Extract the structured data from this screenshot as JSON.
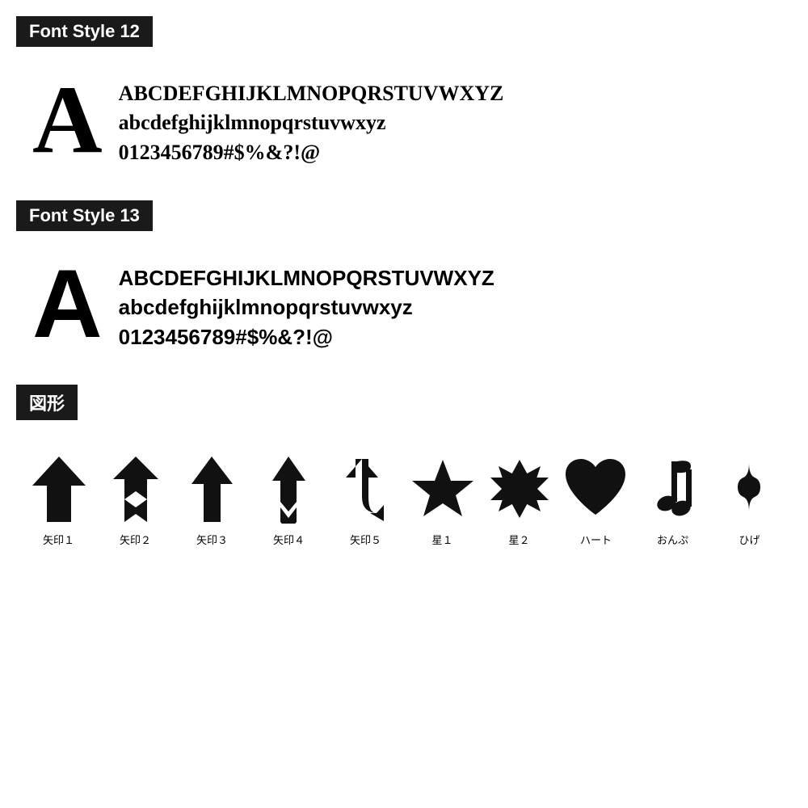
{
  "font12": {
    "header": "Font Style 12",
    "big_letter": "A",
    "line1": "ABCDEFGHIJKLMNOPQRSTUVWXYZ",
    "line2": "abcdefghijklmnopqrstuvwxyz",
    "line3": "0123456789#$%&?!@"
  },
  "font13": {
    "header": "Font Style 13",
    "big_letter": "A",
    "line1": "ABCDEFGHIJKLMNOPQRSTUVWXYZ",
    "line2": "abcdefghijklmnopqrstuvwxyz",
    "line3": "0123456789#$%&?!@"
  },
  "shapes": {
    "header": "図形",
    "items": [
      {
        "label": "矢印１",
        "icon": "arrow1"
      },
      {
        "label": "矢印２",
        "icon": "arrow2"
      },
      {
        "label": "矢印３",
        "icon": "arrow3"
      },
      {
        "label": "矢印４",
        "icon": "arrow4"
      },
      {
        "label": "矢印５",
        "icon": "arrow5"
      },
      {
        "label": "星１",
        "icon": "star1"
      },
      {
        "label": "星２",
        "icon": "star2"
      },
      {
        "label": "ハート",
        "icon": "heart"
      },
      {
        "label": "おんぷ",
        "icon": "music"
      },
      {
        "label": "ひげ",
        "icon": "mustache"
      }
    ]
  }
}
